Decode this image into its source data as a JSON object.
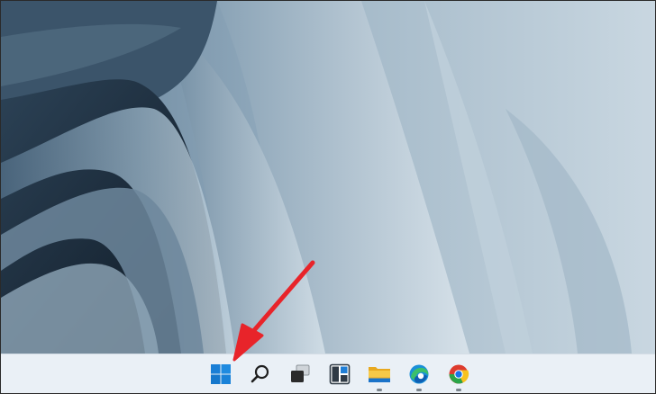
{
  "desktop": {
    "wallpaper": "windows-11-bloom-wallpaper"
  },
  "taskbar": {
    "background_color": "#eaf0f6",
    "items": [
      {
        "id": "start",
        "icon": "windows-logo-icon",
        "running": false
      },
      {
        "id": "search",
        "icon": "search-icon",
        "running": false
      },
      {
        "id": "task-view",
        "icon": "task-view-icon",
        "running": false
      },
      {
        "id": "widgets",
        "icon": "widgets-icon",
        "running": false
      },
      {
        "id": "file-explorer",
        "icon": "folder-icon",
        "running": true
      },
      {
        "id": "edge",
        "icon": "edge-icon",
        "running": true
      },
      {
        "id": "chrome",
        "icon": "chrome-icon",
        "running": true
      }
    ]
  },
  "annotation": {
    "type": "arrow",
    "color": "#e8242a",
    "points_to": "start-button"
  }
}
